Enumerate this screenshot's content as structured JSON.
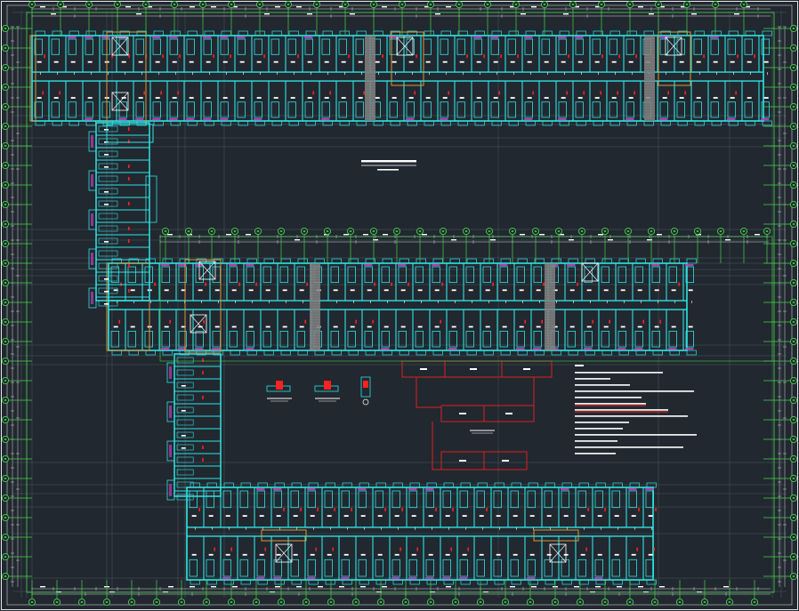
{
  "colors": {
    "background": "#212830",
    "walls": "#2fe3e3",
    "axes": "#48d14a",
    "bubble_stroke": "#48d14a",
    "dims": "#d6d6d6",
    "grid": "#9aa0a6",
    "fixtures": "#ff2020",
    "hatch": "#c13cc1",
    "labels": "#ffffff",
    "stairs": "#888888",
    "outline": "#d89a3a",
    "border": "#e6e6e6"
  },
  "icons": [
    "axis-bubble",
    "room-label-block",
    "stair-block"
  ],
  "notes": {
    "lines": 14,
    "highlighted": [
      5,
      6
    ]
  }
}
